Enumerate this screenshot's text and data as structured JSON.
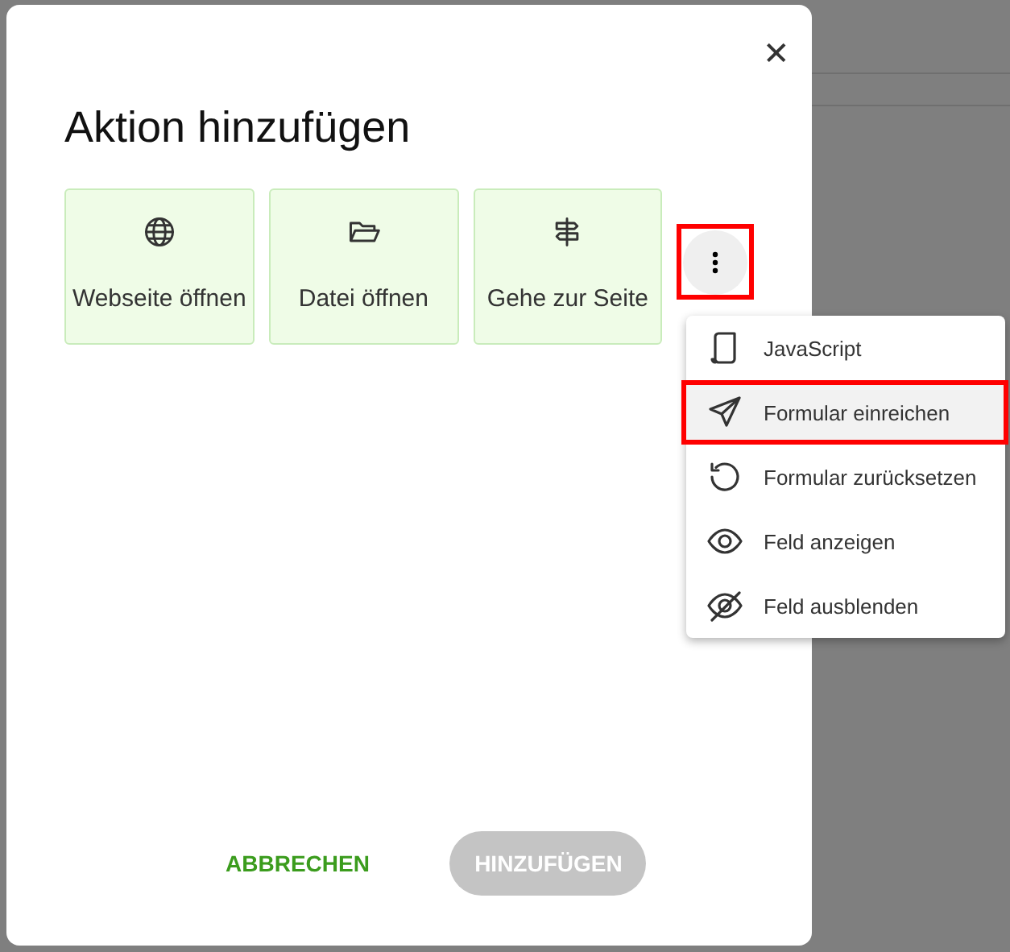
{
  "dialog": {
    "title": "Aktion hinzufügen",
    "close": "✕"
  },
  "actions": [
    {
      "kind": "globe",
      "label": "Webseite öffnen"
    },
    {
      "kind": "folder",
      "label": "Datei öffnen"
    },
    {
      "kind": "signpost",
      "label": "Gehe zur Seite"
    }
  ],
  "more_button": {
    "highlighted": true,
    "expanded": true
  },
  "menu": [
    {
      "kind": "script",
      "label": "JavaScript",
      "selected": false
    },
    {
      "kind": "send",
      "label": "Formular einreichen",
      "selected": true
    },
    {
      "kind": "reset",
      "label": "Formular zurücksetzen",
      "selected": false
    },
    {
      "kind": "eye",
      "label": "Feld anzeigen",
      "selected": false
    },
    {
      "kind": "eye-off",
      "label": "Feld ausblenden",
      "selected": false
    }
  ],
  "buttons": [
    {
      "kind": "text",
      "label": "ABBRECHEN",
      "disabled": false
    },
    {
      "kind": "pill",
      "label": "HINZUFÜGEN",
      "disabled": true
    }
  ]
}
